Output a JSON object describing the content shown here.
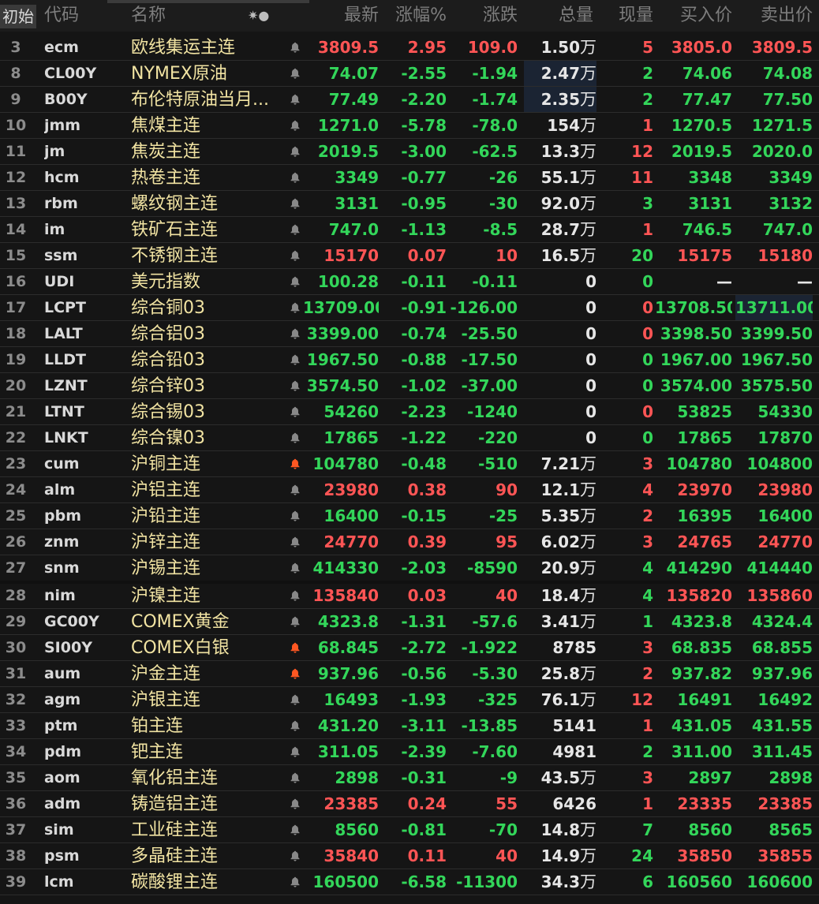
{
  "colors": {
    "up": "#ff5555",
    "down": "#33d65a",
    "neutral": "#e6e6e6",
    "name": "#f1e3a2",
    "bell": "#888888",
    "bell_active": "#ff5722"
  },
  "header": {
    "reset_label": "初始",
    "columns": {
      "code": "代码",
      "name": "名称",
      "icons": "✷●",
      "last": "最新",
      "pct": "涨幅%",
      "chg": "涨跌",
      "vol": "总量",
      "cur": "现量",
      "bid": "买入价",
      "ask": "卖出价"
    }
  },
  "rows": [
    {
      "idx": "3",
      "code": "ecm",
      "name": "欧线集运主连",
      "bell": "off",
      "last": "3809.5",
      "pct": "2.95",
      "chg": "109.0",
      "vol": "1.50",
      "wan": "万",
      "cur": "5",
      "bid": "3805.0",
      "ask": "3809.5",
      "dir": "up",
      "cur_dir": "up",
      "bid_dir": "up",
      "ask_dir": "up"
    },
    {
      "idx": "8",
      "code": "CL00Y",
      "name": "NYMEX原油",
      "bell": "off",
      "last": "74.07",
      "pct": "-2.55",
      "chg": "-1.94",
      "vol": "2.47",
      "wan": "万",
      "cur": "2",
      "bid": "74.06",
      "ask": "74.08",
      "dir": "dn",
      "cur_dir": "dn",
      "bid_dir": "dn",
      "ask_dir": "dn",
      "vol_hl": true
    },
    {
      "idx": "9",
      "code": "B00Y",
      "name": "布伦特原油当月...",
      "bell": "off",
      "last": "77.49",
      "pct": "-2.20",
      "chg": "-1.74",
      "vol": "2.35",
      "wan": "万",
      "cur": "2",
      "bid": "77.47",
      "ask": "77.50",
      "dir": "dn",
      "cur_dir": "dn",
      "bid_dir": "dn",
      "ask_dir": "dn",
      "vol_hl": true
    },
    {
      "idx": "10",
      "code": "jmm",
      "name": "焦煤主连",
      "bell": "off",
      "last": "1271.0",
      "pct": "-5.78",
      "chg": "-78.0",
      "vol": "154",
      "wan": "万",
      "cur": "1",
      "bid": "1270.5",
      "ask": "1271.5",
      "dir": "dn",
      "cur_dir": "up",
      "bid_dir": "dn",
      "ask_dir": "dn"
    },
    {
      "idx": "11",
      "code": "jm",
      "name": "焦炭主连",
      "bell": "off",
      "last": "2019.5",
      "pct": "-3.00",
      "chg": "-62.5",
      "vol": "13.3",
      "wan": "万",
      "cur": "12",
      "bid": "2019.5",
      "ask": "2020.0",
      "dir": "dn",
      "cur_dir": "up",
      "bid_dir": "dn",
      "ask_dir": "dn"
    },
    {
      "idx": "12",
      "code": "hcm",
      "name": "热卷主连",
      "bell": "off",
      "last": "3349",
      "pct": "-0.77",
      "chg": "-26",
      "vol": "55.1",
      "wan": "万",
      "cur": "11",
      "bid": "3348",
      "ask": "3349",
      "dir": "dn",
      "cur_dir": "up",
      "bid_dir": "dn",
      "ask_dir": "dn"
    },
    {
      "idx": "13",
      "code": "rbm",
      "name": "螺纹钢主连",
      "bell": "off",
      "last": "3131",
      "pct": "-0.95",
      "chg": "-30",
      "vol": "92.0",
      "wan": "万",
      "cur": "3",
      "bid": "3131",
      "ask": "3132",
      "dir": "dn",
      "cur_dir": "dn",
      "bid_dir": "dn",
      "ask_dir": "dn"
    },
    {
      "idx": "14",
      "code": "im",
      "name": "铁矿石主连",
      "bell": "off",
      "last": "747.0",
      "pct": "-1.13",
      "chg": "-8.5",
      "vol": "28.7",
      "wan": "万",
      "cur": "1",
      "bid": "746.5",
      "ask": "747.0",
      "dir": "dn",
      "cur_dir": "up",
      "bid_dir": "dn",
      "ask_dir": "dn"
    },
    {
      "idx": "15",
      "code": "ssm",
      "name": "不锈钢主连",
      "bell": "off",
      "last": "15170",
      "pct": "0.07",
      "chg": "10",
      "vol": "16.5",
      "wan": "万",
      "cur": "20",
      "bid": "15175",
      "ask": "15180",
      "dir": "up",
      "cur_dir": "dn",
      "bid_dir": "up",
      "ask_dir": "up"
    },
    {
      "idx": "16",
      "code": "UDI",
      "name": "美元指数",
      "bell": "off",
      "last": "100.28",
      "pct": "-0.11",
      "chg": "-0.11",
      "vol": "0",
      "wan": "",
      "cur": "0",
      "bid": "—",
      "ask": "—",
      "dir": "dn",
      "cur_dir": "dn",
      "bid_dir": "nt",
      "ask_dir": "nt"
    },
    {
      "idx": "17",
      "code": "LCPT",
      "name": "综合铜03",
      "bell": "off",
      "last": "13709.00",
      "pct": "-0.91",
      "chg": "-126.00",
      "vol": "0",
      "wan": "",
      "cur": "0",
      "bid": "13708.50",
      "ask": "13711.00",
      "dir": "dn",
      "cur_dir": "up",
      "bid_dir": "dn",
      "ask_dir": "dn",
      "ask_hl": true
    },
    {
      "idx": "18",
      "code": "LALT",
      "name": "综合铝03",
      "bell": "off",
      "last": "3399.00",
      "pct": "-0.74",
      "chg": "-25.50",
      "vol": "0",
      "wan": "",
      "cur": "0",
      "bid": "3398.50",
      "ask": "3399.50",
      "dir": "dn",
      "cur_dir": "up",
      "bid_dir": "dn",
      "ask_dir": "dn"
    },
    {
      "idx": "19",
      "code": "LLDT",
      "name": "综合铅03",
      "bell": "off",
      "last": "1967.50",
      "pct": "-0.88",
      "chg": "-17.50",
      "vol": "0",
      "wan": "",
      "cur": "0",
      "bid": "1967.00",
      "ask": "1967.50",
      "dir": "dn",
      "cur_dir": "dn",
      "bid_dir": "dn",
      "ask_dir": "dn"
    },
    {
      "idx": "20",
      "code": "LZNT",
      "name": "综合锌03",
      "bell": "off",
      "last": "3574.50",
      "pct": "-1.02",
      "chg": "-37.00",
      "vol": "0",
      "wan": "",
      "cur": "0",
      "bid": "3574.00",
      "ask": "3575.50",
      "dir": "dn",
      "cur_dir": "dn",
      "bid_dir": "dn",
      "ask_dir": "dn"
    },
    {
      "idx": "21",
      "code": "LTNT",
      "name": "综合锡03",
      "bell": "off",
      "last": "54260",
      "pct": "-2.23",
      "chg": "-1240",
      "vol": "0",
      "wan": "",
      "cur": "0",
      "bid": "53825",
      "ask": "54330",
      "dir": "dn",
      "cur_dir": "up",
      "bid_dir": "dn",
      "ask_dir": "dn"
    },
    {
      "idx": "22",
      "code": "LNKT",
      "name": "综合镍03",
      "bell": "off",
      "last": "17865",
      "pct": "-1.22",
      "chg": "-220",
      "vol": "0",
      "wan": "",
      "cur": "0",
      "bid": "17865",
      "ask": "17870",
      "dir": "dn",
      "cur_dir": "dn",
      "bid_dir": "dn",
      "ask_dir": "dn"
    },
    {
      "idx": "23",
      "code": "cum",
      "name": "沪铜主连",
      "bell": "on",
      "last": "104780",
      "pct": "-0.48",
      "chg": "-510",
      "vol": "7.21",
      "wan": "万",
      "cur": "3",
      "bid": "104780",
      "ask": "104800",
      "dir": "dn",
      "cur_dir": "up",
      "bid_dir": "dn",
      "ask_dir": "dn"
    },
    {
      "idx": "24",
      "code": "alm",
      "name": "沪铝主连",
      "bell": "off",
      "last": "23980",
      "pct": "0.38",
      "chg": "90",
      "vol": "12.1",
      "wan": "万",
      "cur": "4",
      "bid": "23970",
      "ask": "23980",
      "dir": "up",
      "cur_dir": "up",
      "bid_dir": "up",
      "ask_dir": "up"
    },
    {
      "idx": "25",
      "code": "pbm",
      "name": "沪铅主连",
      "bell": "off",
      "last": "16400",
      "pct": "-0.15",
      "chg": "-25",
      "vol": "5.35",
      "wan": "万",
      "cur": "2",
      "bid": "16395",
      "ask": "16400",
      "dir": "dn",
      "cur_dir": "up",
      "bid_dir": "dn",
      "ask_dir": "dn"
    },
    {
      "idx": "26",
      "code": "znm",
      "name": "沪锌主连",
      "bell": "off",
      "last": "24770",
      "pct": "0.39",
      "chg": "95",
      "vol": "6.02",
      "wan": "万",
      "cur": "3",
      "bid": "24765",
      "ask": "24770",
      "dir": "up",
      "cur_dir": "up",
      "bid_dir": "up",
      "ask_dir": "up"
    },
    {
      "idx": "27",
      "code": "snm",
      "name": "沪锡主连",
      "bell": "off",
      "last": "414330",
      "pct": "-2.03",
      "chg": "-8590",
      "vol": "20.9",
      "wan": "万",
      "cur": "4",
      "bid": "414290",
      "ask": "414440",
      "dir": "dn",
      "cur_dir": "dn",
      "bid_dir": "dn",
      "ask_dir": "dn"
    },
    {
      "idx": "28",
      "code": "nim",
      "name": "沪镍主连",
      "bell": "off",
      "last": "135840",
      "pct": "0.03",
      "chg": "40",
      "vol": "18.4",
      "wan": "万",
      "cur": "4",
      "bid": "135820",
      "ask": "135860",
      "dir": "up",
      "cur_dir": "dn",
      "bid_dir": "up",
      "ask_dir": "up"
    },
    {
      "idx": "29",
      "code": "GC00Y",
      "name": "COMEX黄金",
      "bell": "off",
      "last": "4323.8",
      "pct": "-1.31",
      "chg": "-57.6",
      "vol": "3.41",
      "wan": "万",
      "cur": "1",
      "bid": "4323.8",
      "ask": "4324.4",
      "dir": "dn",
      "cur_dir": "dn",
      "bid_dir": "dn",
      "ask_dir": "dn"
    },
    {
      "idx": "30",
      "code": "SI00Y",
      "name": "COMEX白银",
      "bell": "on",
      "last": "68.845",
      "pct": "-2.72",
      "chg": "-1.922",
      "vol": "8785",
      "wan": "",
      "cur": "3",
      "bid": "68.835",
      "ask": "68.855",
      "dir": "dn",
      "cur_dir": "up",
      "bid_dir": "dn",
      "ask_dir": "dn"
    },
    {
      "idx": "31",
      "code": "aum",
      "name": "沪金主连",
      "bell": "on",
      "last": "937.96",
      "pct": "-0.56",
      "chg": "-5.30",
      "vol": "25.8",
      "wan": "万",
      "cur": "2",
      "bid": "937.82",
      "ask": "937.96",
      "dir": "dn",
      "cur_dir": "up",
      "bid_dir": "dn",
      "ask_dir": "dn"
    },
    {
      "idx": "32",
      "code": "agm",
      "name": "沪银主连",
      "bell": "off",
      "last": "16493",
      "pct": "-1.93",
      "chg": "-325",
      "vol": "76.1",
      "wan": "万",
      "cur": "12",
      "bid": "16491",
      "ask": "16492",
      "dir": "dn",
      "cur_dir": "up",
      "bid_dir": "dn",
      "ask_dir": "dn"
    },
    {
      "idx": "33",
      "code": "ptm",
      "name": "铂主连",
      "bell": "off",
      "last": "431.20",
      "pct": "-3.11",
      "chg": "-13.85",
      "vol": "5141",
      "wan": "",
      "cur": "1",
      "bid": "431.05",
      "ask": "431.55",
      "dir": "dn",
      "cur_dir": "up",
      "bid_dir": "dn",
      "ask_dir": "dn"
    },
    {
      "idx": "34",
      "code": "pdm",
      "name": "钯主连",
      "bell": "off",
      "last": "311.05",
      "pct": "-2.39",
      "chg": "-7.60",
      "vol": "4981",
      "wan": "",
      "cur": "2",
      "bid": "311.00",
      "ask": "311.45",
      "dir": "dn",
      "cur_dir": "dn",
      "bid_dir": "dn",
      "ask_dir": "dn"
    },
    {
      "idx": "35",
      "code": "aom",
      "name": "氧化铝主连",
      "bell": "off",
      "last": "2898",
      "pct": "-0.31",
      "chg": "-9",
      "vol": "43.5",
      "wan": "万",
      "cur": "3",
      "bid": "2897",
      "ask": "2898",
      "dir": "dn",
      "cur_dir": "up",
      "bid_dir": "dn",
      "ask_dir": "dn"
    },
    {
      "idx": "36",
      "code": "adm",
      "name": "铸造铝主连",
      "bell": "off",
      "last": "23385",
      "pct": "0.24",
      "chg": "55",
      "vol": "6426",
      "wan": "",
      "cur": "1",
      "bid": "23335",
      "ask": "23385",
      "dir": "up",
      "cur_dir": "up",
      "bid_dir": "up",
      "ask_dir": "up"
    },
    {
      "idx": "37",
      "code": "sim",
      "name": "工业硅主连",
      "bell": "off",
      "last": "8560",
      "pct": "-0.81",
      "chg": "-70",
      "vol": "14.8",
      "wan": "万",
      "cur": "7",
      "bid": "8560",
      "ask": "8565",
      "dir": "dn",
      "cur_dir": "dn",
      "bid_dir": "dn",
      "ask_dir": "dn"
    },
    {
      "idx": "38",
      "code": "psm",
      "name": "多晶硅主连",
      "bell": "off",
      "last": "35840",
      "pct": "0.11",
      "chg": "40",
      "vol": "14.9",
      "wan": "万",
      "cur": "24",
      "bid": "35850",
      "ask": "35855",
      "dir": "up",
      "cur_dir": "dn",
      "bid_dir": "up",
      "ask_dir": "up"
    },
    {
      "idx": "39",
      "code": "lcm",
      "name": "碳酸锂主连",
      "bell": "off",
      "last": "160500",
      "pct": "-6.58",
      "chg": "-11300",
      "vol": "34.3",
      "wan": "万",
      "cur": "6",
      "bid": "160560",
      "ask": "160600",
      "dir": "dn",
      "cur_dir": "dn",
      "bid_dir": "dn",
      "ask_dir": "dn"
    }
  ]
}
